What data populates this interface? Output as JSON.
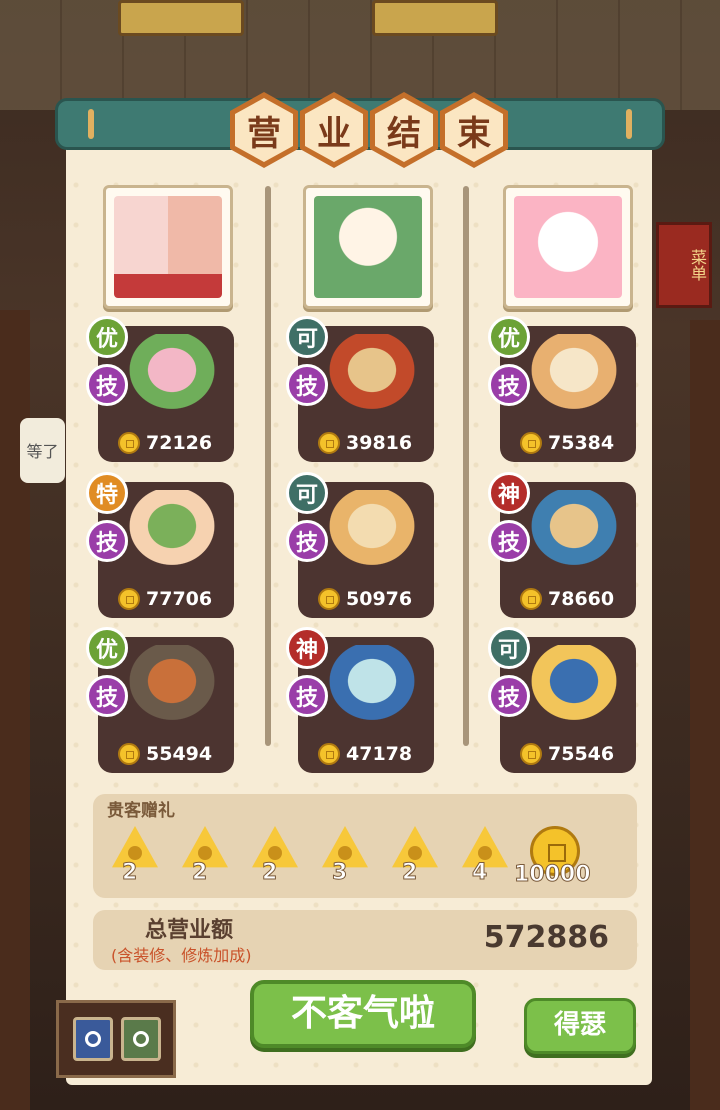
{
  "title_chars": [
    "营",
    "业",
    "结",
    "束"
  ],
  "background": {
    "menu_sign": "菜单",
    "bubble_text": "等了"
  },
  "guests": [
    {
      "avatar_name": "twins-avatar"
    },
    {
      "avatar_name": "white-hair-boy-avatar"
    },
    {
      "avatar_name": "hello-kitty-avatar"
    }
  ],
  "skill_label": "技",
  "dishes": [
    {
      "col": 0,
      "rank": "优",
      "rank_type": "good",
      "score": "72126",
      "icon": "lotus-dish-icon"
    },
    {
      "col": 1,
      "rank": "可",
      "rank_type": "ok",
      "score": "39816",
      "icon": "braised-pork-dish-icon"
    },
    {
      "col": 2,
      "rank": "优",
      "rank_type": "good",
      "score": "75384",
      "icon": "soup-pot-dish-icon"
    },
    {
      "col": 0,
      "rank": "特",
      "rank_type": "spec",
      "score": "77706",
      "icon": "shrimp-dish-icon"
    },
    {
      "col": 1,
      "rank": "可",
      "rank_type": "ok",
      "score": "50976",
      "icon": "fried-rice-dish-icon"
    },
    {
      "col": 2,
      "rank": "神",
      "rank_type": "god",
      "score": "78660",
      "icon": "banquet-dish-icon"
    },
    {
      "col": 0,
      "rank": "优",
      "rank_type": "good",
      "score": "55494",
      "icon": "hotpot-dish-icon"
    },
    {
      "col": 1,
      "rank": "神",
      "rank_type": "god",
      "score": "47178",
      "icon": "porcelain-bowl-dish-icon"
    },
    {
      "col": 2,
      "rank": "可",
      "rank_type": "ok",
      "score": "75546",
      "icon": "chrysanthemum-dish-icon"
    }
  ],
  "gifts": {
    "title": "贵客赠礼",
    "items": [
      {
        "count": "2",
        "icon": "zongzi-gift-icon"
      },
      {
        "count": "2",
        "icon": "zongzi-gift-icon"
      },
      {
        "count": "2",
        "icon": "zongzi-gift-icon"
      },
      {
        "count": "3",
        "icon": "zongzi-gift-icon"
      },
      {
        "count": "2",
        "icon": "zongzi-gift-icon"
      },
      {
        "count": "4",
        "icon": "zongzi-gift-icon"
      }
    ],
    "coin_amount": "10000"
  },
  "total": {
    "label": "总营业额",
    "sub": "(含装修、修炼加成)",
    "value": "572886"
  },
  "buttons": {
    "main": "不客气啦",
    "side": "得瑟"
  },
  "colors": {
    "teal_bar": "#3e7a72",
    "panel": "#f7ecd6",
    "card": "#4c3430",
    "green_button": "#7cc04a",
    "coin": "#f4c22a"
  }
}
